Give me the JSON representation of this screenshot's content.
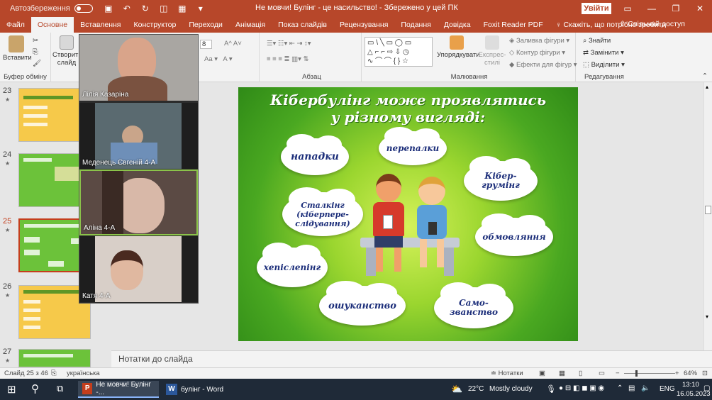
{
  "titlebar": {
    "autosave_label": "Автозбереження",
    "document_title": "Не мовчи! Булінг - це насильство!  -  Збережено у цей ПК",
    "signin_label": "Увійти"
  },
  "tabs": [
    {
      "label": "Файл"
    },
    {
      "label": "Основне"
    },
    {
      "label": "Вставлення"
    },
    {
      "label": "Конструктор"
    },
    {
      "label": "Переходи"
    },
    {
      "label": "Анімація"
    },
    {
      "label": "Показ слайдів"
    },
    {
      "label": "Рецензування"
    },
    {
      "label": "Подання"
    },
    {
      "label": "Довідка"
    },
    {
      "label": "Foxit Reader PDF"
    },
    {
      "label": "Скажіть, що потрібно зробити"
    }
  ],
  "share_label": "Спільний доступ",
  "ribbon": {
    "paste_label": "Вставити",
    "clipboard_label": "Буфер обміну",
    "new_slide_label": "Створити слайд",
    "font_size": "8",
    "paragraph_label": "Абзац",
    "arrange_label": "Упорядкувати",
    "quick_styles_label": "Експрес-стилі",
    "shape_fill_label": "Заливка фігури",
    "shape_outline_label": "Контур фігури",
    "shape_effects_label": "Ефекти для фігур",
    "drawing_label": "Малювання",
    "find_label": "Знайти",
    "replace_label": "Замінити",
    "select_label": "Виділити",
    "editing_label": "Редагування"
  },
  "thumbnails": [
    {
      "num": "23",
      "selected": false
    },
    {
      "num": "24",
      "selected": false
    },
    {
      "num": "25",
      "selected": true
    },
    {
      "num": "26",
      "selected": false
    },
    {
      "num": "27",
      "selected": false
    }
  ],
  "video_participants": [
    {
      "name": "Лілія Казаріна"
    },
    {
      "name": "Меденець Євгеній 4-А"
    },
    {
      "name": "Аліна 4-А"
    },
    {
      "name": "Катя  4-А"
    }
  ],
  "slide": {
    "title_line1": "Кібербулінг може проявлятись",
    "title_line2": "у різному вигляді:",
    "clouds": [
      {
        "text": "нападки"
      },
      {
        "text": "перепалки"
      },
      {
        "text": "Кібер-\nгрумінг"
      },
      {
        "text": "Сталкінг\n(кіберпере-\nслідування)"
      },
      {
        "text": "обмовляння"
      },
      {
        "text": "хепіслепінг"
      },
      {
        "text": "ошуканство"
      },
      {
        "text": "Само-\nзванство"
      }
    ]
  },
  "notes_placeholder": "Нотатки до слайда",
  "status": {
    "slide_counter": "Слайд 25 з 46",
    "language": "українська",
    "notes_label": "Нотатки",
    "zoom": "64%"
  },
  "taskbar": {
    "app1": "Не мовчи! Булінг -...",
    "app2": "булінг - Word",
    "temperature": "22°C",
    "weather": "Mostly cloudy",
    "lang": "ENG",
    "time": "13:10",
    "date": "16.05.2023"
  },
  "colors": {
    "accent": "#b7472a",
    "selected": "#c43e1c",
    "cloud_text": "#1c2e7a"
  }
}
